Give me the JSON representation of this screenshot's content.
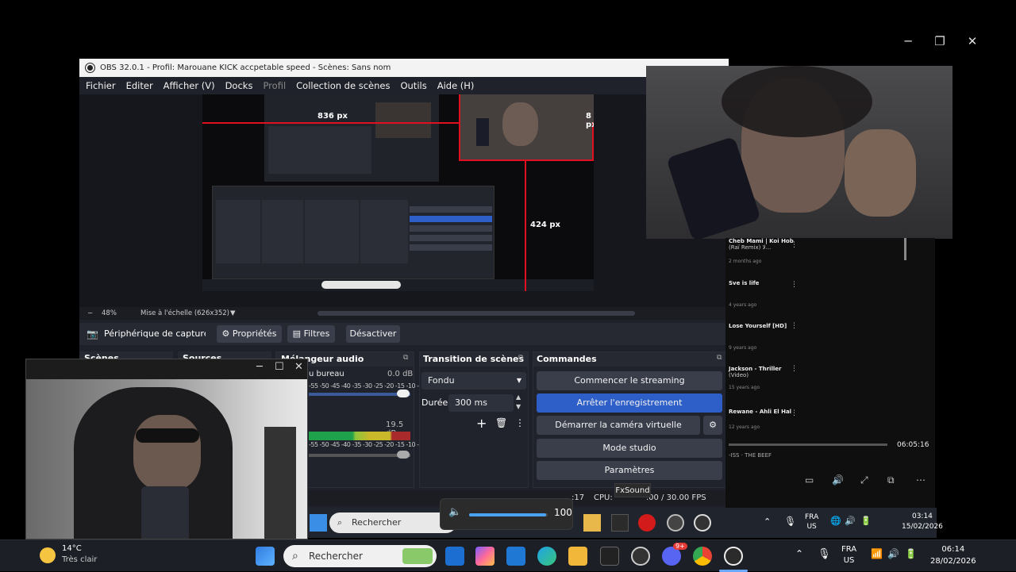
{
  "obs": {
    "title": "OBS 32.0.1 - Profil: Marouane KICK accpetable speed - Scènes: Sans nom",
    "menu": [
      "Fichier",
      "Editer",
      "Afficher (V)",
      "Docks",
      "Profil",
      "Collection de scènes",
      "Outils",
      "Aide (H)"
    ],
    "preview_labels": {
      "width_left": "836 px",
      "width_right": "8 px",
      "height_bottom": "424 px"
    },
    "zoom": {
      "minus": "−",
      "percent": "48%",
      "scale_mode": "Mise à l'échelle (626x352)"
    },
    "source_toolbar": {
      "source_name": "Périphérique de capture vic",
      "properties": "Propriétés",
      "filters": "Filtres",
      "deactivate": "Désactiver"
    },
    "docks": {
      "scenes": "Scènes",
      "sources": "Sources",
      "mixer": "Mélangeur audio",
      "transitions": "Transition de scènes",
      "commands": "Commandes"
    },
    "mixer": {
      "track1_name": "u bureau",
      "track1_db": "0.0 dB",
      "track2_db": "19.5 dB",
      "scale": "-55 -50 -45 -40 -35 -30 -25 -20 -15 -10 -5 0"
    },
    "transition": {
      "type": "Fondu",
      "duration_label": "Durée",
      "duration_value": "300 ms"
    },
    "commands": {
      "start_stream": "Commencer le streaming",
      "stop_record": "Arrêter l'enregistrement",
      "virtual_cam": "Démarrer la caméra virtuelle",
      "studio_mode": "Mode studio",
      "settings": "Paramètres"
    },
    "status": {
      "time_partial": ":17",
      "cpu": "CPU: ",
      "fps": ".00 / 30.00 FPS"
    }
  },
  "fxsound": {
    "label": "FxSound",
    "volume": "100",
    "volume_fraction": 0.98
  },
  "bgapp": {
    "items": [
      {
        "title": "Cheb Mami | Koi Hob",
        "meta": "(Raï Remix) لا...",
        "age": "2 months ago"
      },
      {
        "title": "Sve is life",
        "meta": "",
        "age": "4 years ago"
      },
      {
        "title": "Lose Yourself [HD]",
        "meta": "",
        "age": "9 years ago"
      },
      {
        "title": "Jackson - Thriller",
        "meta": "(Video)",
        "age": "15 years ago"
      },
      {
        "title": "Rewane - Ahli El Hal",
        "meta": "",
        "age": "12 years ago"
      }
    ],
    "time": "06:05:16",
    "now_playing": "-ISS · THE BEEF"
  },
  "inner_taskbar": {
    "search": "Rechercher",
    "lang": "FRA",
    "region": "US",
    "time": "03:14",
    "date": "15/02/2026"
  },
  "taskbar": {
    "weather_temp": "14°C",
    "weather_desc": "Très clair",
    "search": "Rechercher",
    "lang": "FRA",
    "region": "US",
    "time": "06:14",
    "date": "28/02/2026",
    "discord_badge": "9+"
  }
}
